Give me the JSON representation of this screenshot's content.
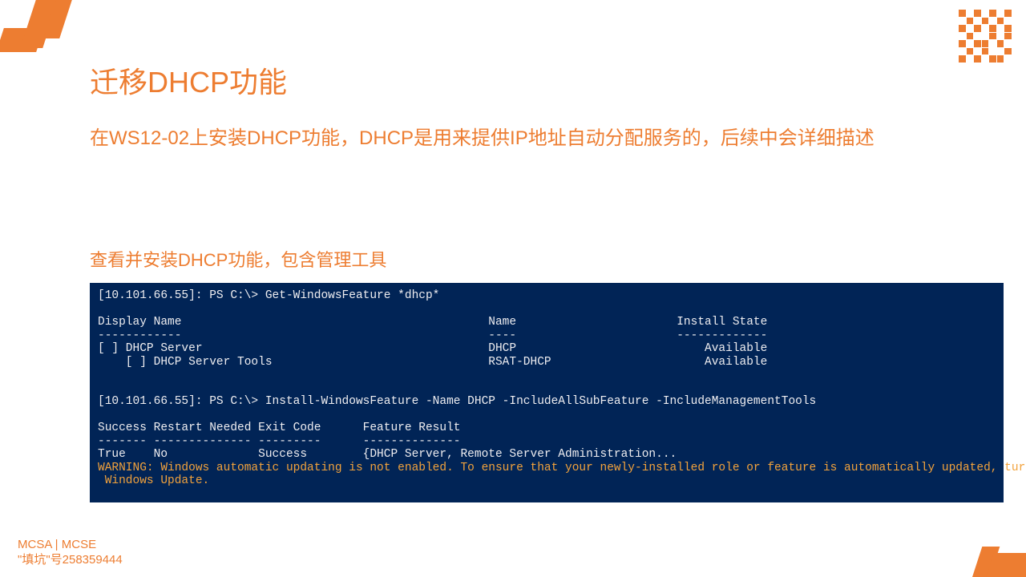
{
  "title": "迁移DHCP功能",
  "subtitle": "在WS12-02上安装DHCP功能，DHCP是用来提供IP地址自动分配服务的，后续中会详细描述",
  "section_head": "查看并安装DHCP功能，包含管理工具",
  "terminal": {
    "line1": "[10.101.66.55]: PS C:\\> Get-WindowsFeature *dhcp*",
    "blank1": "",
    "header": "Display Name                                            Name                       Install State",
    "divider": "------------                                            ----                       -------------",
    "row1": "[ ] DHCP Server                                         DHCP                           Available",
    "row2": "    [ ] DHCP Server Tools                               RSAT-DHCP                      Available",
    "blank2": "",
    "blank3": "",
    "line2": "[10.101.66.55]: PS C:\\> Install-WindowsFeature -Name DHCP -IncludeAllSubFeature -IncludeManagementTools",
    "blank4": "",
    "header2": "Success Restart Needed Exit Code      Feature Result",
    "divider2": "------- -------------- ---------      --------------",
    "row3": "True    No             Success        {DHCP Server, Remote Server Administration...",
    "warn": "WARNING: Windows automatic updating is not enabled. To ensure that your newly-installed role or feature is automatically updated, turn on\n Windows Update."
  },
  "footer": {
    "line1": "MCSA | MCSE",
    "line2": "\"填坑\"号258359444"
  }
}
